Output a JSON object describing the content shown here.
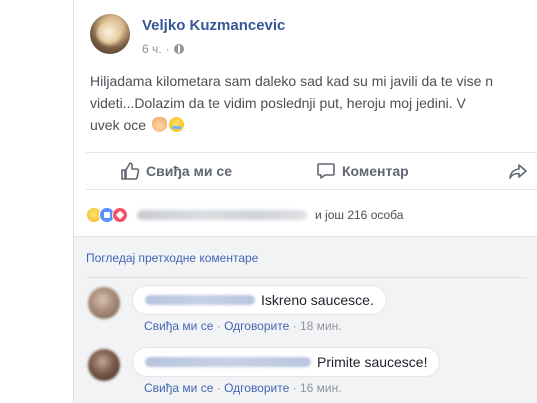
{
  "post": {
    "author": "Veljko Kuzmancevic",
    "time": "6 ч.",
    "privacy_icon": "globe-icon",
    "text_lines": [
      "Hiljadama kilometara sam daleko sad kad su mi javili da te vise n",
      "videti...Dolazim da te vidim poslednji put, heroju moj jedini. V",
      "uvek oce"
    ],
    "text_emojis": [
      "pray-emoji",
      "sob-emoji"
    ]
  },
  "actions": {
    "like": "Свиђа ми се",
    "comment": "Коментар"
  },
  "reactions": {
    "icons": [
      "sad-reaction",
      "like-reaction",
      "love-reaction"
    ],
    "count_text": "и још 216 особа"
  },
  "comments": {
    "view_previous": "Погледај претходне коментаре",
    "items": [
      {
        "text": "Iskreno saucesce.",
        "like": "Свиђа ми се",
        "reply": "Одговорите",
        "time": "18 мин."
      },
      {
        "text": "Primite saucesce!",
        "like": "Свиђа ми се",
        "reply": "Одговорите",
        "time": "16 мин."
      }
    ],
    "separator": "·"
  },
  "colors": {
    "link": "#365899",
    "accent": "#4267b2",
    "muted": "#90949c",
    "comment_bg": "#f2f3f5"
  }
}
